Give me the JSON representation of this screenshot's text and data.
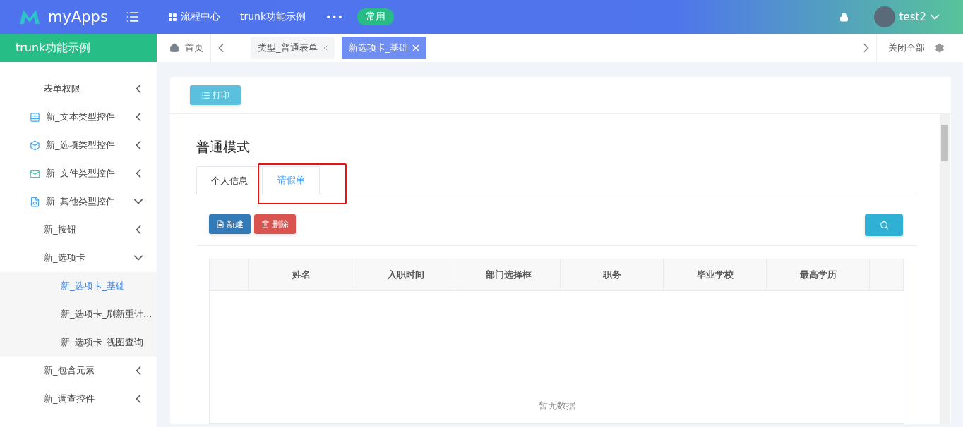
{
  "header": {
    "logo": "myApps",
    "nav": [
      {
        "label": "流程中心",
        "kind": "grid"
      },
      {
        "label": "trunk功能示例",
        "kind": "plain"
      },
      {
        "label": "•••",
        "kind": "plain"
      }
    ],
    "badge": "常用",
    "user": "test2"
  },
  "sidebar": {
    "title": "trunk功能示例",
    "items": [
      {
        "label": "表单权限",
        "expanded": false
      },
      {
        "label": "新_文本类型控件",
        "kind": "table",
        "expanded": false
      },
      {
        "label": "新_选项类型控件",
        "kind": "cube",
        "expanded": false
      },
      {
        "label": "新_文件类型控件",
        "kind": "mail",
        "expanded": false
      },
      {
        "label": "新_其他类型控件",
        "kind": "file",
        "expanded": true,
        "children": [
          {
            "label": "新_按钮",
            "expanded": false
          },
          {
            "label": "新_选项卡",
            "expanded": true,
            "children": [
              {
                "label": "新_选项卡_基础",
                "selected": true
              },
              {
                "label": "新_选项卡_刷新重计...",
                "selected": false
              },
              {
                "label": "新_选项卡_视图查询",
                "selected": false
              }
            ]
          },
          {
            "label": "新_包含元素",
            "expanded": false
          },
          {
            "label": "新_调查控件",
            "expanded": false
          }
        ]
      }
    ]
  },
  "tabbar": {
    "home": "首页",
    "tabs": [
      {
        "label": "类型_普通表单",
        "selected": false
      },
      {
        "label": "新选项卡_基础",
        "selected": true
      }
    ],
    "close_all": "关闭全部"
  },
  "page": {
    "print": "打印",
    "title": "普通模式",
    "tabs": [
      {
        "label": "个人信息",
        "selected": false
      },
      {
        "label": "请假单",
        "selected": true
      }
    ],
    "actions": [
      {
        "label": "新建",
        "kind": "new"
      },
      {
        "label": "删除",
        "kind": "delete"
      }
    ],
    "table": {
      "columns": [
        "姓名",
        "入职时间",
        "部门选择框",
        "职务",
        "毕业学校",
        "最高学历"
      ],
      "empty": "暂无数据"
    }
  }
}
